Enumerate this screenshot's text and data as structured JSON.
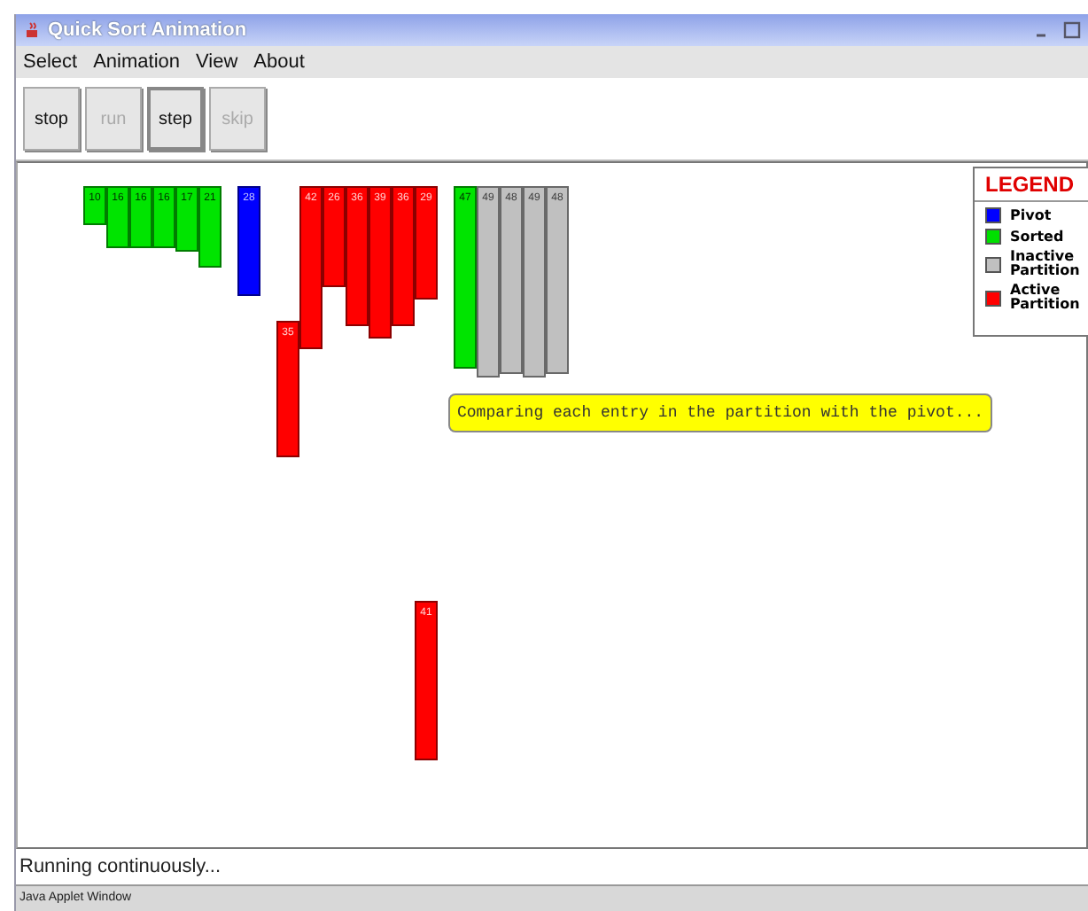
{
  "window": {
    "title": "Quick Sort Animation"
  },
  "menu": [
    "Select",
    "Animation",
    "View",
    "About"
  ],
  "toolbar": [
    {
      "label": "stop",
      "disabled": false,
      "pressed": false
    },
    {
      "label": "run",
      "disabled": true,
      "pressed": false
    },
    {
      "label": "step",
      "disabled": false,
      "pressed": true
    },
    {
      "label": "skip",
      "disabled": true,
      "pressed": false
    }
  ],
  "groups": [
    {
      "columns": [
        {
          "top": {
            "value": "10",
            "kind": "sorted"
          }
        },
        {
          "top": {
            "value": "16",
            "kind": "sorted"
          }
        },
        {
          "top": {
            "value": "16",
            "kind": "sorted"
          }
        },
        {
          "top": {
            "value": "16",
            "kind": "sorted"
          }
        },
        {
          "top": {
            "value": "17",
            "kind": "sorted"
          }
        },
        {
          "top": {
            "value": "21",
            "kind": "sorted"
          }
        }
      ]
    },
    {
      "columns": [
        {
          "top": {
            "value": "28",
            "kind": "pivot"
          }
        }
      ]
    },
    {
      "columns": [
        {
          "middle": {
            "value": "35",
            "kind": "active"
          }
        },
        {
          "top": {
            "value": "42",
            "kind": "active"
          }
        },
        {
          "top": {
            "value": "26",
            "kind": "active"
          }
        },
        {
          "top": {
            "value": "36",
            "kind": "active"
          }
        },
        {
          "top": {
            "value": "39",
            "kind": "active"
          }
        },
        {
          "top": {
            "value": "36",
            "kind": "active"
          }
        },
        {
          "top": {
            "value": "29",
            "kind": "active"
          },
          "bottom": {
            "value": "41",
            "kind": "active"
          }
        }
      ]
    },
    {
      "columns": [
        {
          "top": {
            "value": "47",
            "kind": "sorted"
          }
        },
        {
          "top": {
            "value": "49",
            "kind": "inactive"
          }
        },
        {
          "top": {
            "value": "48",
            "kind": "inactive"
          }
        },
        {
          "top": {
            "value": "49",
            "kind": "inactive"
          }
        },
        {
          "top": {
            "value": "48",
            "kind": "inactive"
          }
        }
      ]
    }
  ],
  "message": "Comparing each entry in the partition with the pivot...",
  "legend": {
    "title": "LEGEND",
    "items": [
      {
        "label": "Pivot",
        "color": "#0000ff"
      },
      {
        "label": "Sorted",
        "color": "#00e000"
      },
      {
        "label": "Inactive Partition",
        "color": "#c0c0c0"
      },
      {
        "label": "Active Partition",
        "color": "#ff0000"
      }
    ]
  },
  "status": "Running continuously...",
  "footer": "Java Applet Window"
}
